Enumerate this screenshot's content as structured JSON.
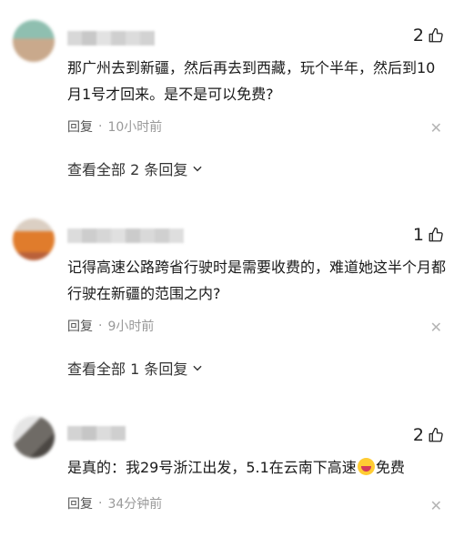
{
  "comments": [
    {
      "likes": "2",
      "text": "那广州去到新疆，然后再去到西藏，玩个半年，然后到10月1号才回来。是不是可以免费?",
      "reply_label": "回复",
      "separator": "·",
      "time": "10小时前",
      "view_replies": "查看全部 2 条回复"
    },
    {
      "likes": "1",
      "text": "记得高速公路跨省行驶时是需要收费的，难道她这半个月都行驶在新疆的范围之内?",
      "reply_label": "回复",
      "separator": "·",
      "time": "9小时前",
      "view_replies": "查看全部 1 条回复"
    },
    {
      "likes": "2",
      "text_before_emoji": "是真的：我29号浙江出发，5.1在云南下高速",
      "emoji": "laughing-emoji",
      "text_after_emoji": "免费",
      "reply_label": "回复",
      "separator": "·",
      "time": "34分钟前"
    }
  ],
  "icons": {
    "like": "thumbs-up-icon",
    "close": "close-icon",
    "chevron": "chevron-down-icon"
  },
  "colors": {
    "text": "#1a1a1a",
    "meta": "#999999",
    "close": "#b5b5b5"
  }
}
